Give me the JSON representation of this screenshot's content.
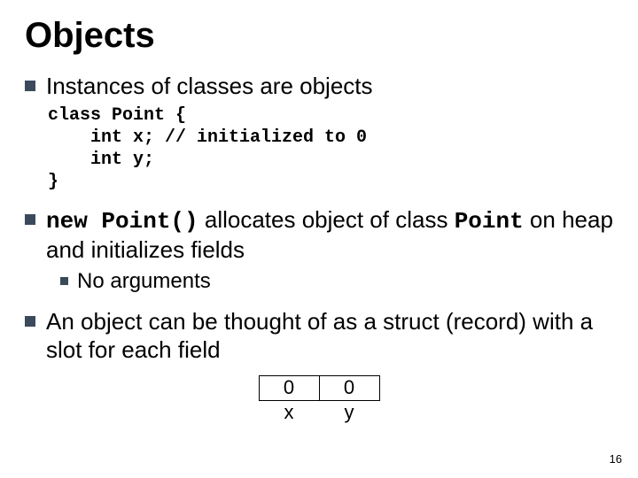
{
  "title": "Objects",
  "bullet1": "Instances of classes are objects",
  "code": "class Point {\n    int x; // initialized to 0\n    int y;\n}",
  "bullet2": {
    "mono": "new Point()",
    "mid": " allocates object of class ",
    "mono2": "Point",
    "tail": " on heap and initializes fields"
  },
  "bullet2sub": "No arguments",
  "bullet3": "An object can be thought of as a struct (record) with a slot for each field",
  "table": {
    "val_x": "0",
    "val_y": "0",
    "lbl_x": "x",
    "lbl_y": "y"
  },
  "page": "16"
}
